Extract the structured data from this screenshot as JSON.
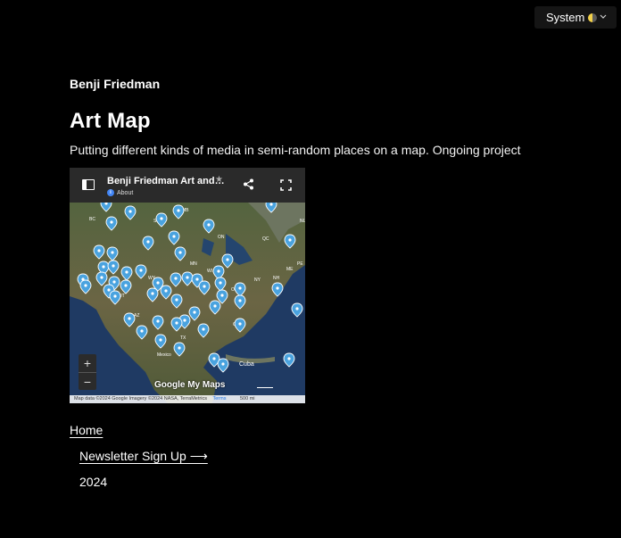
{
  "theme": {
    "label": "System",
    "icon": "half-moon-icon"
  },
  "site": {
    "name": "Benji Friedman"
  },
  "page": {
    "title": "Art Map",
    "subtitle": "Putting different kinds of media in semi-random places on a map. Ongoing project"
  },
  "map": {
    "title": "Benji Friedman Art and…",
    "about_label": "About",
    "zoom_in": "+",
    "zoom_out": "−",
    "logo": "Google My Maps",
    "attribution": "Map data ©2024 Google Imagery ©2024 NASA, TerraMetrics",
    "terms": "Terms",
    "scale": "500 mi",
    "labels": [
      "BC",
      "MB",
      "SK",
      "ON",
      "QC",
      "NL",
      "PE",
      "ME",
      "NH",
      "MN",
      "WI",
      "NY",
      "OH",
      "WY",
      "UT",
      "AZ",
      "TX",
      "GA",
      "Cuba",
      "Mexico"
    ],
    "colors": {
      "land": "#4b5c3a",
      "water": "#1f3a63",
      "pin": "#4aa3df"
    }
  },
  "nav": {
    "home": "Home",
    "newsletter": "Newsletter Sign Up ⟶",
    "year": "2024"
  }
}
